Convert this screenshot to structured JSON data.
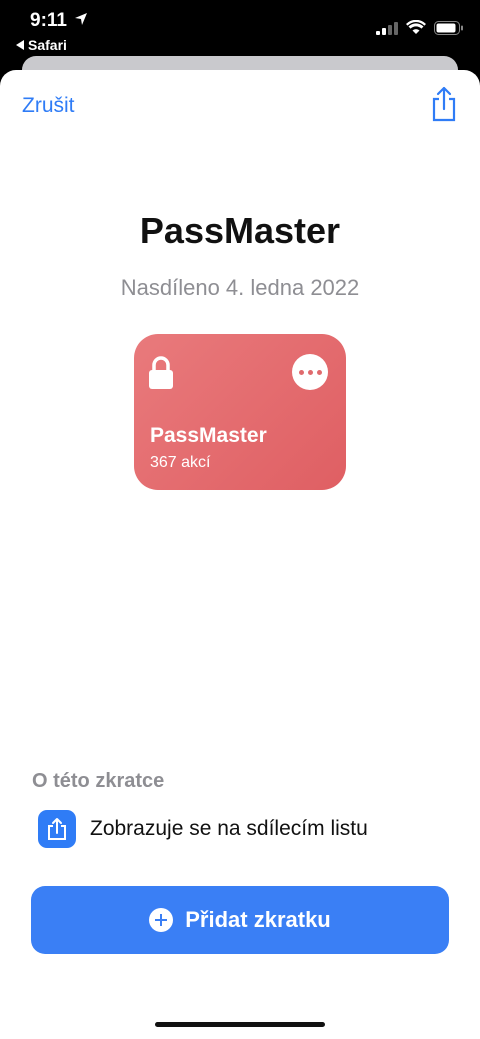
{
  "status_bar": {
    "time": "9:11",
    "back_app": "Safari"
  },
  "header": {
    "cancel_label": "Zrušit"
  },
  "shortcut": {
    "title": "PassMaster",
    "shared_date": "Nasdíleno 4. ledna 2022",
    "card_name": "PassMaster",
    "card_actions": "367 akcí",
    "card_color": "#e06a6d"
  },
  "about": {
    "header": "O této zkratce",
    "feature_text": "Zobrazuje se na sdílecím listu"
  },
  "add_button": {
    "label": "Přidat zkratku",
    "color": "#3a7ff5"
  },
  "accent_color": "#2f7cf6"
}
